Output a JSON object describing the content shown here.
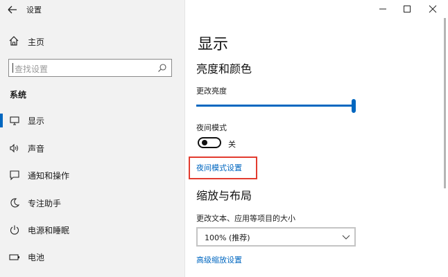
{
  "window": {
    "title": "设置"
  },
  "sidebar": {
    "home_label": "主页",
    "search_placeholder": "查找设置",
    "section_label": "系统",
    "items": [
      {
        "label": "显示",
        "icon": "monitor-icon"
      },
      {
        "label": "声音",
        "icon": "speaker-icon"
      },
      {
        "label": "通知和操作",
        "icon": "notification-icon"
      },
      {
        "label": "专注助手",
        "icon": "moon-icon"
      },
      {
        "label": "电源和睡眠",
        "icon": "power-icon"
      },
      {
        "label": "电池",
        "icon": "battery-icon"
      }
    ],
    "selected_index": 0
  },
  "main": {
    "page_title": "显示",
    "section_brightness_title": "亮度和颜色",
    "brightness_label": "更改亮度",
    "brightness_value": 1.0,
    "night_mode_label": "夜间模式",
    "night_mode_state": "关",
    "night_mode_settings_link": "夜间模式设置",
    "section_scale_title": "缩放与布局",
    "scale_label": "更改文本、应用等项目的大小",
    "scale_value": "100% (推荐)",
    "advanced_scale_link": "高级缩放设置"
  },
  "colors": {
    "accent": "#0067c0",
    "highlight_box": "#e23b2e",
    "sidebar_bg": "#f2f2f2"
  }
}
